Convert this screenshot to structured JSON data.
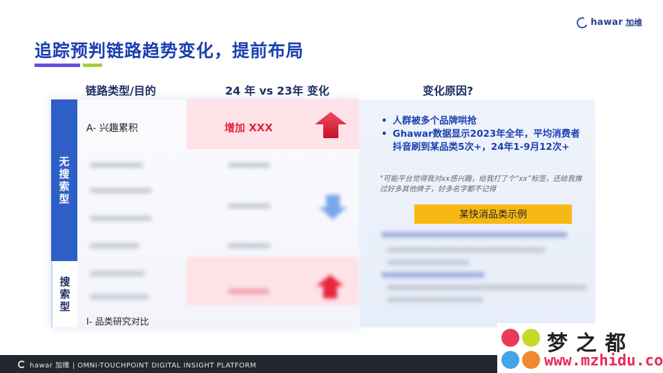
{
  "brand": {
    "logo_latin": "hawar",
    "logo_cn": "加维"
  },
  "page": {
    "title": "追踪预判链路趋势变化，提前布局"
  },
  "table": {
    "headers": {
      "type": "链路类型/目的",
      "change": "24 年 vs 23年 变化",
      "reason": "变化原因?"
    },
    "groups": {
      "no_search": "无搜索型",
      "search": "搜索型"
    },
    "row_a": {
      "label": "A- 兴趣累积",
      "change": "增加 XXX"
    },
    "row_i": {
      "label": "I- 品类研究对比"
    }
  },
  "reasons": {
    "bullets": [
      "人群被多个品牌哄抢",
      "Ghawar数据显示2023年全年，平均消费者抖音刷到某品类5次+，24年1-9月12次+"
    ],
    "quote": "\"可能平台觉得我对xx感兴趣，给我打了个“xx”标签，还给我推过好多其他牌子，好多名字都不记得",
    "example_label": "某快消品类示例"
  },
  "footer": {
    "text": "hawar 加维 | OMNI-TOUCHPOINT DIGITAL INSIGHT PLATFORM"
  },
  "watermark": {
    "cn": "梦之都",
    "url": "www.mzhidu.com"
  },
  "colors": {
    "accent": "#1a3fb0",
    "sidebar": "#2e5fc7",
    "up": "#e8243b",
    "highlight": "#f6b913"
  }
}
